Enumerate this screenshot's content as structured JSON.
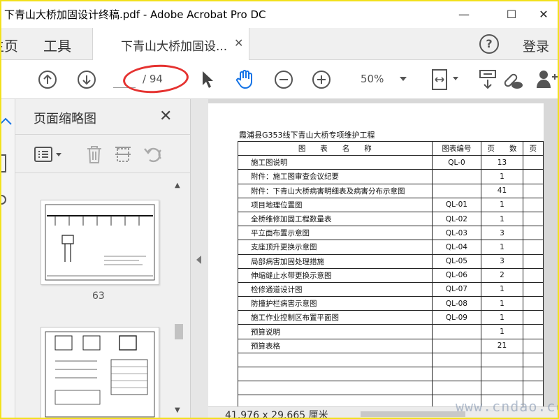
{
  "window": {
    "title": "下青山大桥加固设计终稿.pdf - Adobe Acrobat Pro DC",
    "minimize": "—",
    "maximize": "☐",
    "close": "✕"
  },
  "tabs": {
    "home": "主页",
    "tools": "工具",
    "doc_tab": "下青山大桥加固设...",
    "doc_tab_close": "✕",
    "help": "?",
    "login": "登录"
  },
  "toolbar": {
    "page_current": "",
    "page_total": "/ 94",
    "zoom": "50%",
    "annotation_color": "#e53230"
  },
  "sidebar": {
    "title": "页面缩略图",
    "close": "✕",
    "thumb_page_number": "63"
  },
  "document": {
    "title": "霞浦县G353线下青山大桥专项维护工程",
    "headers": [
      "图　　表　　名　　称",
      "图表编号",
      "页　　数",
      "页"
    ],
    "rows": [
      [
        "施工图说明",
        "QL-0",
        "13"
      ],
      [
        "附件：施工图审查会议纪要",
        "",
        "1"
      ],
      [
        "附件：下青山大桥病害明细表及病害分布示意图",
        "",
        "41"
      ],
      [
        "项目地理位置图",
        "QL-01",
        "1"
      ],
      [
        "全桥维修加固工程数量表",
        "QL-02",
        "1"
      ],
      [
        "平立面布置示意图",
        "QL-03",
        "3"
      ],
      [
        "支座顶升更换示意图",
        "QL-04",
        "1"
      ],
      [
        "局部病害加固处理措施",
        "QL-05",
        "3"
      ],
      [
        "伸缩缝止水带更换示意图",
        "QL-06",
        "2"
      ],
      [
        "检修通道设计图",
        "QL-07",
        "1"
      ],
      [
        "防撞护栏病害示意图",
        "QL-08",
        "1"
      ],
      [
        "施工作业控制区布置平面图",
        "QL-09",
        "1"
      ],
      [
        "预算说明",
        "",
        "1"
      ],
      [
        "预算表格",
        "",
        "21"
      ],
      [
        "",
        "",
        ""
      ],
      [
        "",
        "",
        ""
      ],
      [
        "",
        "",
        ""
      ],
      [
        "",
        "",
        ""
      ]
    ]
  },
  "status": {
    "page_size": "41.976 x 29.665 厘米"
  },
  "watermark": "www.cndao.com"
}
